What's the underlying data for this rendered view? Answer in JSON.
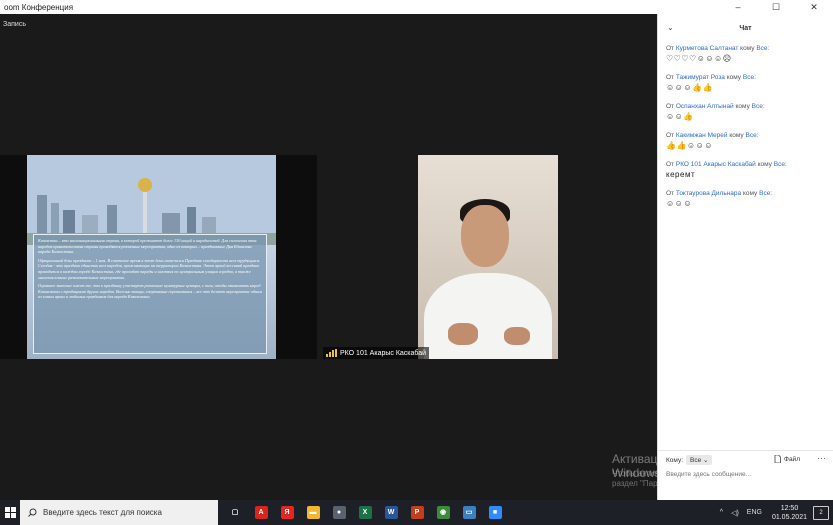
{
  "window": {
    "title": "oom Конференция",
    "minimize_glyph": "–",
    "maximize_glyph": "☐",
    "close_glyph": "✕"
  },
  "meeting": {
    "recording_label": "Запись",
    "participant_name": "РКО 101 Акарыс Каскабай",
    "slide_paragraphs": [
      "Казахстан – это многонациональная страна, в которой проживают более 130 наций и народностей. Для сплочения этих народов правительством страны проводятся различные мероприятия, одно из которых – празднование Дня Единства народа Казахстана.",
      "Официальный день праздника – 1 мая. В советское время в этот день отмечался Праздник солидарности всех трудящихся. Сегодня - это праздник единства всех народов, проживающих на территории Казахстана. Этот яркий весенний праздник проводится в каждом городе Казахстана, где проходят парады и шествия по центральным улицам городов, а также многочисленные развлекательные мероприятия.",
      "Огромное значение имеет то, что к празднику участвуют различные культурные центры, с тем, чтобы ознакомить народ Казахстана с традициями других народов. Веселые танцы, спортивные соревнования – все это делают мероприятие одним из самых ярких и любимых праздников для народа Казахстана."
    ],
    "windows_activation_title": "Активация Windows",
    "windows_activation_sub": "Чтобы активировать Windows, перейдите в раздел \"Параметры\"."
  },
  "chat": {
    "title": "Чат",
    "collapse_glyph": "⌄",
    "from_prefix": "От",
    "to_word": "кому",
    "messages": [
      {
        "sender": "Курметова Салтанат",
        "recipient": "Все:",
        "body": "♡♡♡♡☺☺☺☹"
      },
      {
        "sender": "Тажимурат Роза",
        "recipient": "Все:",
        "body": "☺☺☺👍👍"
      },
      {
        "sender": "Оспанхан Алтынай",
        "recipient": "Все:",
        "body": "☺☺👍"
      },
      {
        "sender": "Какимжан Мерей",
        "recipient": "Все:",
        "body": "👍👍☺☺☺"
      },
      {
        "sender": "РКО 101 Акарыс Каскабай",
        "recipient": "Все:",
        "body": "керемт"
      },
      {
        "sender": "Токтаурова Дильнара",
        "recipient": "Все:",
        "body": "☺☺☺"
      }
    ],
    "to_label": "Кому:",
    "to_value": "Все",
    "file_label": "Файл",
    "more_glyph": "···",
    "input_placeholder": "Введите здесь сообщение..."
  },
  "taskbar": {
    "search_placeholder": "Введите здесь текст для поиска",
    "apps": [
      {
        "name": "task-view",
        "glyph": "▢",
        "color": "#1d2026"
      },
      {
        "name": "acrobat",
        "glyph": "A",
        "color": "#d9261c"
      },
      {
        "name": "yandex",
        "glyph": "Я",
        "color": "#e52620"
      },
      {
        "name": "file-explorer",
        "glyph": "▬",
        "color": "#f2b632"
      },
      {
        "name": "camera",
        "glyph": "●",
        "color": "#5a6270"
      },
      {
        "name": "excel",
        "glyph": "X",
        "color": "#1e7145"
      },
      {
        "name": "word",
        "glyph": "W",
        "color": "#2b579a"
      },
      {
        "name": "powerpoint",
        "glyph": "P",
        "color": "#c43e1c"
      },
      {
        "name": "chrome",
        "glyph": "◉",
        "color": "#3b8b3b"
      },
      {
        "name": "desktop",
        "glyph": "▭",
        "color": "#3d7fbf"
      },
      {
        "name": "zoom",
        "glyph": "■",
        "color": "#2d8cff"
      }
    ],
    "language": "ENG",
    "time": "12:50",
    "date": "01.05.2021",
    "notification_count": "2"
  }
}
